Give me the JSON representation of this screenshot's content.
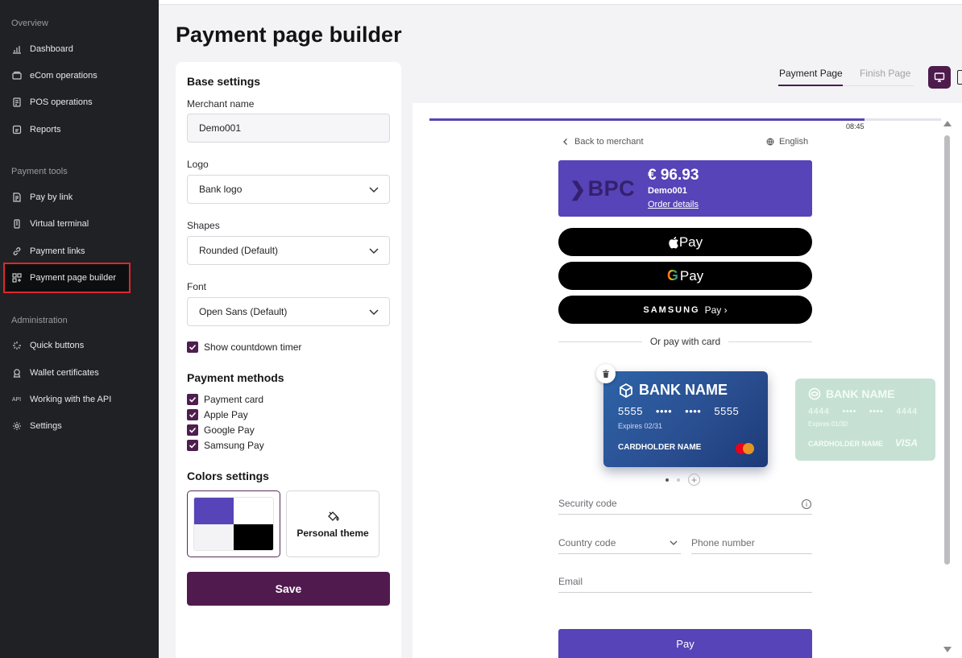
{
  "sidebar": {
    "sections": {
      "overview": "Overview",
      "payment_tools": "Payment tools",
      "administration": "Administration"
    },
    "items": [
      {
        "label": "Dashboard",
        "icon": "bar-chart-icon"
      },
      {
        "label": "eCom operations",
        "icon": "monitor-icon"
      },
      {
        "label": "POS operations",
        "icon": "pos-terminal-icon"
      },
      {
        "label": "Reports",
        "icon": "report-icon"
      },
      {
        "label": "Pay by link",
        "icon": "invoice-icon"
      },
      {
        "label": "Virtual terminal",
        "icon": "terminal-icon"
      },
      {
        "label": "Payment links",
        "icon": "link-icon"
      },
      {
        "label": "Payment page builder",
        "icon": "builder-grid-icon",
        "active": true
      },
      {
        "label": "Quick buttons",
        "icon": "sparkle-icon"
      },
      {
        "label": "Wallet certificates",
        "icon": "ribbon-icon"
      },
      {
        "label": "Working with the API",
        "icon": "api-icon"
      },
      {
        "label": "Settings",
        "icon": "gear-icon"
      }
    ]
  },
  "page": {
    "title": "Payment page builder"
  },
  "settings": {
    "base_title": "Base settings",
    "merchant_label": "Merchant name",
    "merchant_value": "Demo001",
    "logo_label": "Logo",
    "logo_value": "Bank logo",
    "shapes_label": "Shapes",
    "shapes_value": "Rounded (Default)",
    "font_label": "Font",
    "font_value": "Open Sans (Default)",
    "countdown_label": "Show countdown timer",
    "countdown_checked": true,
    "methods_title": "Payment methods",
    "methods": [
      {
        "label": "Payment card",
        "checked": true
      },
      {
        "label": "Apple Pay",
        "checked": true
      },
      {
        "label": "Google Pay",
        "checked": true
      },
      {
        "label": "Samsung Pay",
        "checked": true
      }
    ],
    "colors_title": "Colors settings",
    "swatch_colors": [
      "#5644b8",
      "#ffffff",
      "#f3f3f5",
      "#000000"
    ],
    "personal_theme_label": "Personal theme",
    "save_label": "Save"
  },
  "preview_tabs": {
    "payment_page": "Payment Page",
    "finish_page": "Finish Page"
  },
  "preview": {
    "timer": "08:45",
    "timer_progress": 0.85,
    "back_label": "Back to merchant",
    "language": "English",
    "logo_text": "BPC",
    "amount": "€ 96.93",
    "merchant": "Demo001",
    "order_details": "Order details",
    "apple_pay": "Pay",
    "google_pay": "Pay",
    "samsung_brand": "SAMSUNG",
    "samsung_pay": "Pay ›",
    "or_card": "Or pay with card",
    "card1": {
      "bank": "BANK NAME",
      "number": [
        "5555",
        "••••",
        "••••",
        "5555"
      ],
      "expires": "Expires 02/31",
      "holder": "CARDHOLDER NAME"
    },
    "card2": {
      "bank": "BANK NAME",
      "number": [
        "4444",
        "••••",
        "••••",
        "4444"
      ],
      "expires": "Expires 01/30",
      "holder": "CARDHOLDER NAME",
      "network": "VISA"
    },
    "security_code": "Security code",
    "country_code": "Country code",
    "phone_number": "Phone number",
    "email": "Email",
    "pay_label": "Pay"
  },
  "colors": {
    "accent": "#5644b8",
    "brand_dark": "#501a4f",
    "sidebar_bg": "#1f2124"
  }
}
